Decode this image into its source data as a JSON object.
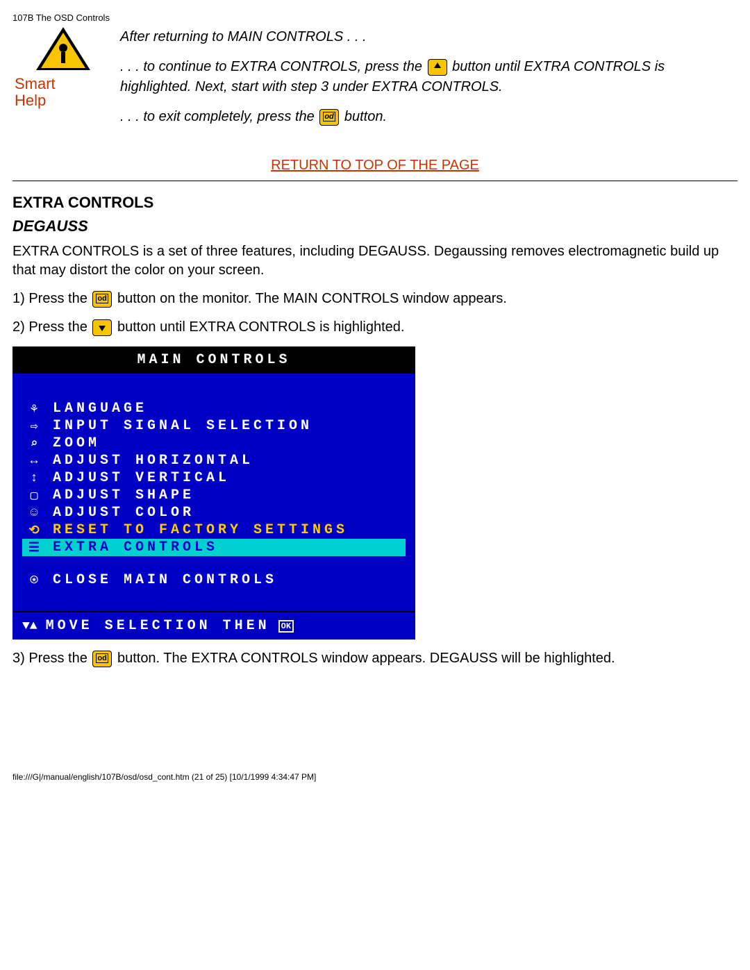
{
  "header": "107B The OSD Controls",
  "smartHelp": {
    "label1": "Smart",
    "label2": "Help",
    "line1": "After returning to MAIN CONTROLS . . .",
    "line2a": ". . . to continue to EXTRA CONTROLS, press the ",
    "line2b": " button until EXTRA CONTROLS is highlighted. Next, start with step 3 under EXTRA CONTROLS.",
    "line3a": ". . . to exit completely, press the ",
    "line3b": " button."
  },
  "returnLink": "RETURN TO TOP OF THE PAGE",
  "sectionTitle": "EXTRA CONTROLS",
  "subTitle": "DEGAUSS",
  "intro": "EXTRA CONTROLS is a set of three features, including DEGAUSS. Degaussing removes electromagnetic build up that may distort the color on your screen.",
  "step1a": "1) Press the ",
  "step1b": " button on the monitor. The MAIN CONTROLS window appears.",
  "step2a": "2) Press the ",
  "step2b": " button until EXTRA CONTROLS is highlighted.",
  "step3a": "3) Press the ",
  "step3b": " button. The EXTRA CONTROLS window appears. DEGAUSS will be highlighted.",
  "osd": {
    "title": "MAIN CONTROLS",
    "items": [
      {
        "icon": "⚘",
        "label": "LANGUAGE"
      },
      {
        "icon": "⇨",
        "label": "INPUT SIGNAL SELECTION"
      },
      {
        "icon": "⌕",
        "label": "ZOOM"
      },
      {
        "icon": "↔",
        "label": "ADJUST HORIZONTAL"
      },
      {
        "icon": "↕",
        "label": "ADJUST VERTICAL"
      },
      {
        "icon": "▢",
        "label": "ADJUST SHAPE"
      },
      {
        "icon": "☺",
        "label": "ADJUST COLOR"
      },
      {
        "icon": "⟲",
        "label": "RESET TO FACTORY SETTINGS"
      },
      {
        "icon": "☰",
        "label": "EXTRA CONTROLS"
      }
    ],
    "closeIcon": "⍟",
    "closeLabel": "CLOSE MAIN CONTROLS",
    "footerArrows": "▼▲",
    "footerText": "MOVE SELECTION THEN",
    "footerOk": "OK"
  },
  "footer": "file:///G|/manual/english/107B/osd/osd_cont.htm (21 of 25) [10/1/1999 4:34:47 PM]"
}
